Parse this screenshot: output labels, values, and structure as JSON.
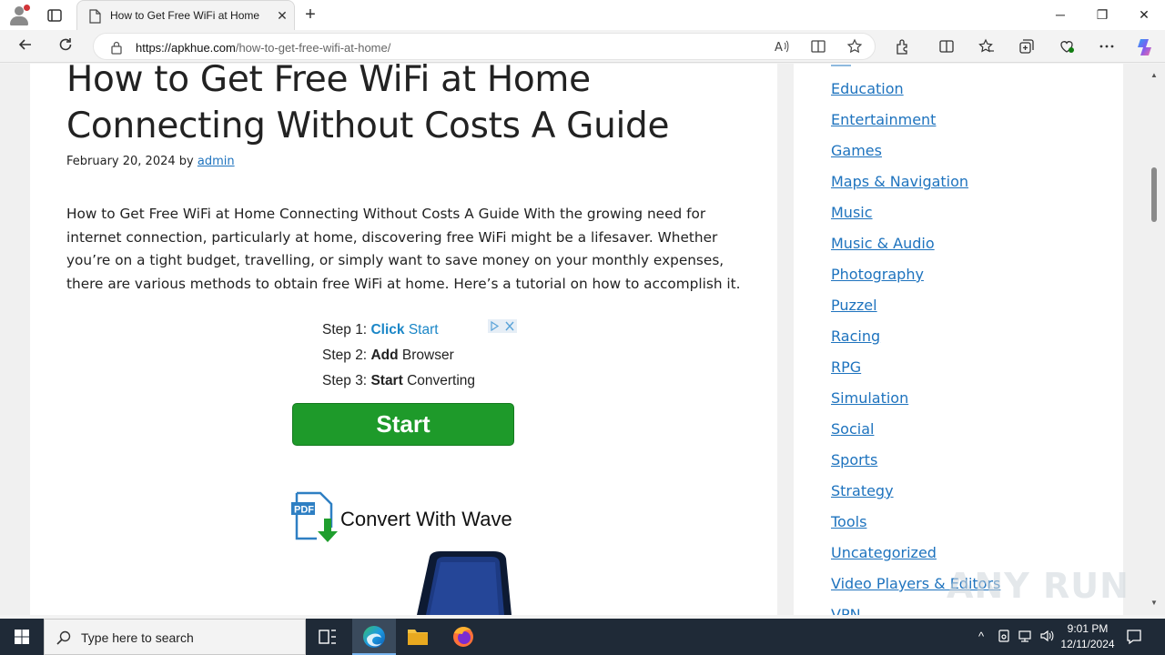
{
  "browser": {
    "tab_title": "How to Get Free WiFi at Home",
    "tab_close": "✕",
    "new_tab": "+",
    "window_controls": {
      "minimize": "─",
      "maximize": "❐",
      "close": "✕"
    },
    "url_host": "https://apkhue.com",
    "url_path": "/how-to-get-free-wifi-at-home/"
  },
  "article": {
    "title": "How to Get Free WiFi at Home Connecting Without Costs A Guide",
    "date": "February 20, 2024",
    "by": "by",
    "author": "admin",
    "body": "How to Get Free WiFi at Home Connecting Without Costs A Guide With the growing need for internet connection, particularly at home, discovering free WiFi might be a lifesaver. Whether you’re on a tight budget, travelling, or simply want to save money on your monthly expenses, there are various methods to obtain free WiFi at home. Here’s a tutorial on how to accomplish it."
  },
  "ad": {
    "step1_prefix": "Step 1:",
    "step1_action": "Click",
    "step1_object": "Start",
    "step2_prefix": "Step 2:",
    "step2_action": "Add",
    "step2_object": "Browser",
    "step3_prefix": "Step 3:",
    "step3_action": "Start",
    "step3_object": "Converting",
    "start_button": "Start",
    "convert_text": "Convert With Wave",
    "pdf_label": "PDF"
  },
  "sidebar": {
    "categories": [
      "Education",
      "Entertainment",
      "Games",
      "Maps & Navigation",
      "Music",
      "Music & Audio",
      "Photography",
      "Puzzel",
      "Racing",
      "RPG",
      "Simulation",
      "Social",
      "Sports",
      "Strategy",
      "Tools",
      "Uncategorized",
      "Video Players & Editors",
      "VPN"
    ]
  },
  "watermark": {
    "text": "ANY RUN"
  },
  "taskbar": {
    "search_placeholder": "Type here to search",
    "time": "9:01 PM",
    "date": "12/11/2024"
  },
  "colors": {
    "link": "#1e73be",
    "start_green": "#1e9a2a",
    "taskbar": "#1f2a37"
  }
}
